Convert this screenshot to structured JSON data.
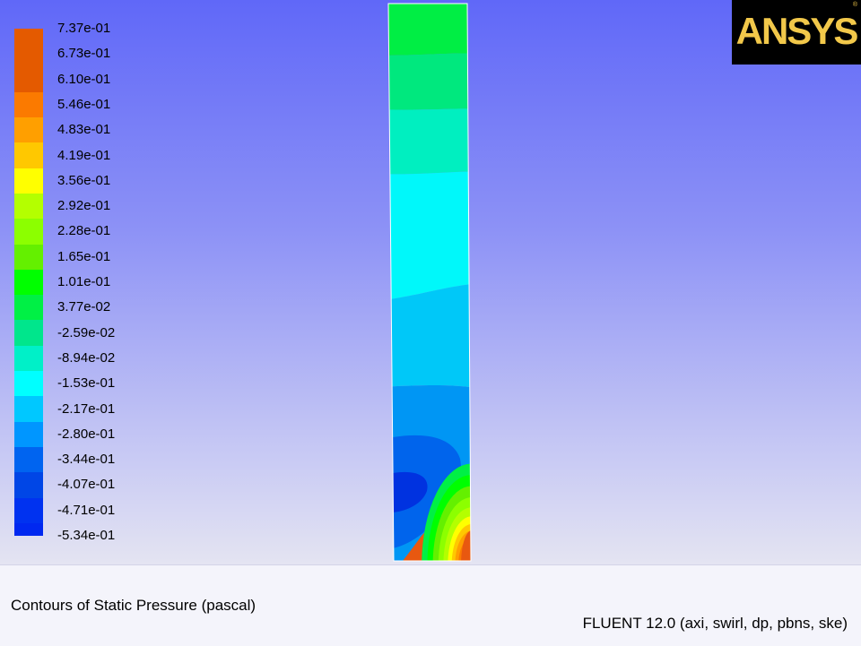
{
  "logo": {
    "text": "ANSYS",
    "mark": "®"
  },
  "caption": {
    "title": "Contours of Static Pressure (pascal)",
    "solver": "FLUENT 12.0 (axi, swirl, dp, pbns, ske)"
  },
  "chart_data": {
    "type": "heatmap",
    "title": "Contours of Static Pressure (pascal)",
    "colorbar": {
      "levels": [
        "7.37e-01",
        "6.73e-01",
        "6.10e-01",
        "5.46e-01",
        "4.83e-01",
        "4.19e-01",
        "3.56e-01",
        "2.92e-01",
        "2.28e-01",
        "1.65e-01",
        "1.01e-01",
        "3.77e-02",
        "-2.59e-02",
        "-8.94e-02",
        "-1.53e-01",
        "-2.17e-01",
        "-2.80e-01",
        "-3.44e-01",
        "-4.07e-01",
        "-4.71e-01",
        "-5.34e-01"
      ],
      "values": [
        0.737,
        0.673,
        0.61,
        0.546,
        0.483,
        0.419,
        0.356,
        0.292,
        0.228,
        0.165,
        0.101,
        0.0377,
        -0.0259,
        -0.0894,
        -0.153,
        -0.217,
        -0.28,
        -0.344,
        -0.407,
        -0.471,
        -0.534
      ],
      "colors": [
        "#e45a00",
        "#e45a00",
        "#e45a00",
        "#fb7a00",
        "#ff9f00",
        "#ffc800",
        "#ffff00",
        "#b4ff00",
        "#8cff00",
        "#64f000",
        "#00ff00",
        "#00f045",
        "#00e68c",
        "#00f0c8",
        "#00ffff",
        "#00c8ff",
        "#0096ff",
        "#0064f0",
        "#0046e6",
        "#0032f0",
        "#0028f0"
      ]
    },
    "domain_zones": [
      {
        "pressure": 0.0,
        "color": "#00ee44"
      },
      {
        "pressure": -0.05,
        "color": "#00e87e"
      },
      {
        "pressure": -0.12,
        "color": "#00efc0"
      },
      {
        "pressure": -0.18,
        "color": "#00f8fa"
      },
      {
        "pressure": -0.25,
        "color": "#00c8f8"
      },
      {
        "pressure": -0.31,
        "color": "#0096f4"
      },
      {
        "pressure": -0.38,
        "color": "#0064ec"
      },
      {
        "pressure": -0.5,
        "color": "#0032e0"
      },
      {
        "pressure": 0.67,
        "color": "#e85810"
      }
    ],
    "accent": "#5d66f7"
  }
}
